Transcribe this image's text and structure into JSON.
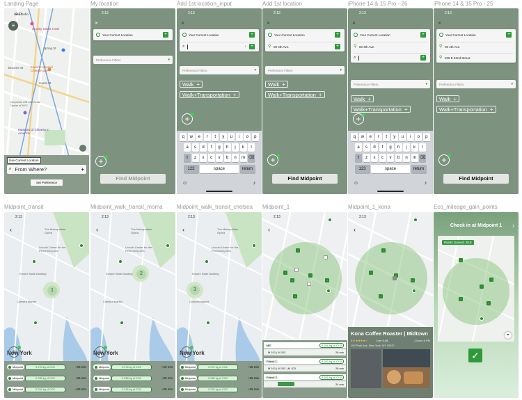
{
  "frames": {
    "f1": {
      "label": "Landing Page",
      "time": "2:13",
      "use_current": "Use Current Location",
      "from_placeholder": "From Where?",
      "set_pref": "Set Preference",
      "map_labels": [
        "Nike Soho",
        "Crosby Street Hotel",
        "Spring St",
        "Broome St",
        "Canal St",
        "Eileen's Special Cheesecake",
        "Museum of Chinese in America",
        "Corporate Gift Certificate Center of NYC"
      ]
    },
    "f2": {
      "label": "My location",
      "time": "2:13",
      "current": "Your Current Location",
      "filters": "Preference Filters",
      "find": "Find Midpoint"
    },
    "f3": {
      "label": "Add 1st location_input",
      "time": "2:13",
      "current": "Your Current Location",
      "filters": "Preference Filters",
      "chip1": "Walk",
      "chip2": "Walk+Transportation"
    },
    "f4": {
      "label": "Add 1st location",
      "time": "2:13",
      "current": "Your Current Location",
      "addr": "00 4th Ave.",
      "filters": "Preference Filters",
      "chip1": "Walk",
      "chip2": "Walk+Transportation",
      "find": "Find Midpoint"
    },
    "f5": {
      "label": "iPhone 14 & 15 Pro - 26",
      "time": "2:13",
      "current": "Your Current Location",
      "addr": "00 4th Ave.",
      "filters": "Preference Filters",
      "chip1": "Walk",
      "chip2": "Walk+Transportation"
    },
    "f6": {
      "label": "iPhone 14 & 15 Pro - 25",
      "time": "2:13",
      "current": "Your Current Location",
      "addr1": "00 4th Ave.",
      "addr2": "205 E 62nd Street",
      "filters": "Preference Filters",
      "chip1": "Walk",
      "chip2": "Walk+Transportation",
      "find": "Find Midpoint"
    },
    "f7": {
      "label": "Midpoint_transit",
      "time": "2:13",
      "marker": "1",
      "map_labels": [
        "The Metropolitan Opera",
        "Lincoln Center for the Performing Arts",
        "Empire State Building",
        "Chelsea Market",
        "New York"
      ]
    },
    "f8": {
      "label": "Midpoint_walk_transit_moma",
      "time": "2:13",
      "marker": "2",
      "map_labels": [
        "The Metropolitan Opera",
        "Lincoln Center for the Performing Arts",
        "Empire State Building",
        "Chelsea Market",
        "New York"
      ]
    },
    "f9": {
      "label": "Midpoint_walk_transit_chelsea",
      "time": "2:13",
      "marker": "3",
      "map_labels": [
        "The Metropolitan Opera",
        "Lincoln Center for the Performing Arts",
        "Empire State Building",
        "Chelsea Market",
        "New York"
      ]
    },
    "f10": {
      "label": "Midpoint_1",
      "time": "2:13",
      "friends": [
        {
          "name": "ME",
          "co2": "0.268 kg of CO2",
          "time": "26 min",
          "route": "M 101 | M 102"
        },
        {
          "name": "Friend 1",
          "co2": "0.283 kg of CO2",
          "time": "26 min",
          "route": "M 101 | M 102 | M 103"
        },
        {
          "name": "Friend 2",
          "co2": "0.285 kg of CO2",
          "time": "24 min",
          "route": ""
        }
      ]
    },
    "f11": {
      "label": "Midpoint_1_kona",
      "time": "2:13",
      "place": "Kona Coffee Roaster | Midtown",
      "rating": "4.6",
      "cat": "Cafe $-$$",
      "hours": "Closes 8 PM",
      "address": "100 Park Ave, New York, NY 10017"
    },
    "f12": {
      "label": "Eco_mileage_gain_points",
      "checkin": "Check in at Midpoint 1",
      "points": "Points Gained: 28.8"
    }
  },
  "co2_rows": [
    {
      "label": "Midpoint",
      "co2": "0.276 kg of CO2",
      "time": "~26 min"
    },
    {
      "label": "Midpoint",
      "co2": "0.285 kg of CO2",
      "time": "~26 min"
    },
    {
      "label": "Midpoint",
      "co2": "0.234 kg of CO2",
      "time": "~25 min"
    }
  ],
  "keyboard": {
    "row1": [
      "q",
      "w",
      "e",
      "r",
      "t",
      "y",
      "u",
      "i",
      "o",
      "p"
    ],
    "row2": [
      "a",
      "s",
      "d",
      "f",
      "g",
      "h",
      "j",
      "k",
      "l"
    ],
    "row3": [
      "z",
      "x",
      "c",
      "v",
      "b",
      "n",
      "m"
    ],
    "num": "123",
    "space": "space",
    "ret": "return"
  },
  "colors": {
    "sage": "#7e9280",
    "green": "#2f9a3a",
    "map": "#e9eef1"
  }
}
